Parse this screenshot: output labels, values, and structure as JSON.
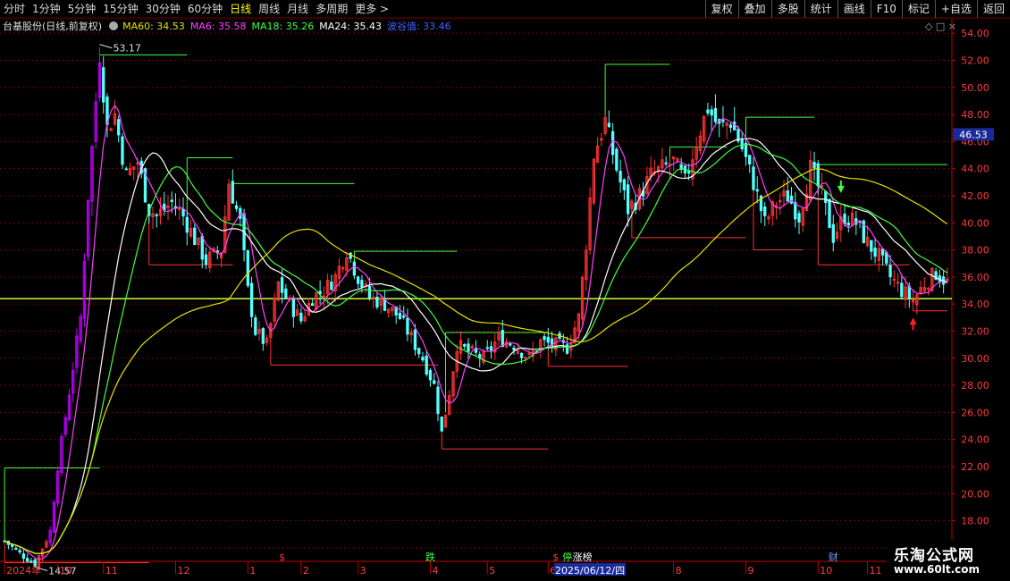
{
  "toolbar": {
    "periods": [
      "分时",
      "1分钟",
      "5分钟",
      "15分钟",
      "30分钟",
      "60分钟",
      "日线",
      "周线",
      "月线",
      "多周期",
      "更多 >"
    ],
    "active_period": "日线",
    "tools": [
      "复权",
      "叠加",
      "多股",
      "统计",
      "画线",
      "F10",
      "标记",
      "+自选",
      "返回"
    ]
  },
  "infobar": {
    "stock": "台基股份(日线,前复权)",
    "ma60": "MA60: 34.53",
    "ma6": "MA6: 35.58",
    "ma18": "MA18: 35.26",
    "ma24": "MA24: 35.43",
    "extra": "波谷值: 33.46"
  },
  "icons": {
    "settings": "gear-icon",
    "diamond": "diamond-icon",
    "close": "close-icon"
  },
  "corner_icons": "◇ □ ×",
  "watermark": {
    "line1": "乐淘公式网",
    "line2": "www.60lt.com"
  },
  "colors": {
    "up": "#ff3232",
    "down": "#54ffff",
    "limit": "#c000ff",
    "ma60": "#e8e000",
    "ma6": "#ff40ff",
    "ma18": "#ffffff",
    "ma24": "#40ff40",
    "grid": "#7a0000",
    "axis": "#c00000"
  },
  "chart_data": {
    "type": "candlestick",
    "title": "台基股份(日线,前复权)",
    "ylim": [
      15,
      55
    ],
    "yticks": [
      16,
      18,
      20,
      22,
      24,
      26,
      28,
      30,
      32,
      34,
      36,
      38,
      40,
      42,
      44,
      46,
      48,
      50,
      52,
      54
    ],
    "last_price": 46.53,
    "month_labels": [
      {
        "label": "2024年",
        "t": 0
      },
      {
        "label": "10",
        "t": 14
      },
      {
        "label": "11",
        "t": 26
      },
      {
        "label": "12",
        "t": 45
      },
      {
        "label": "1",
        "t": 64
      },
      {
        "label": "2",
        "t": 78
      },
      {
        "label": "3",
        "t": 93
      },
      {
        "label": "4",
        "t": 112
      },
      {
        "label": "5",
        "t": 127
      },
      {
        "label": "6",
        "t": 143
      },
      {
        "label": "7",
        "t": 156
      },
      {
        "label": "8",
        "t": 176
      },
      {
        "label": "9",
        "t": 195
      },
      {
        "label": "10",
        "t": 214
      },
      {
        "label": "11",
        "t": 227
      }
    ],
    "date_cursor": {
      "label": "2025/06/12/四",
      "t": 146
    },
    "event_marks": [
      {
        "label": "$",
        "t": 73,
        "color": "#ff3232"
      },
      {
        "label": "跌",
        "t": 112,
        "color": "#40ff40"
      },
      {
        "label": "$",
        "t": 145,
        "color": "#ff3232"
      },
      {
        "label": "停",
        "t": 148,
        "color": "#40ff40"
      },
      {
        "label": "涨榜",
        "t": 152,
        "color": "#ffffff"
      },
      {
        "label": "财",
        "t": 218,
        "color": "#6fa0ff"
      }
    ],
    "annotations": [
      {
        "label": "53.17",
        "t": 25,
        "value": 53.17
      },
      {
        "label": "14.57",
        "t": 8,
        "value": 14.57
      }
    ],
    "horizontal_line": 34.4,
    "arrows": [
      {
        "direction": "down",
        "color": "#40ff40",
        "t": 220,
        "value": 42.2
      },
      {
        "direction": "up",
        "color": "#ff2020",
        "t": 239,
        "value": 33.0
      }
    ],
    "levels": [
      {
        "t0": 25,
        "t1": 48,
        "value": 52.4,
        "color": "#40ff40"
      },
      {
        "t0": 0,
        "t1": 25,
        "value": 21.9,
        "color": "#40ff40"
      },
      {
        "t0": 0,
        "t1": 38,
        "value": 14.9,
        "color": "#ff3232"
      },
      {
        "t0": 48,
        "t1": 60,
        "value": 44.8,
        "color": "#40ff40"
      },
      {
        "t0": 60,
        "t1": 92,
        "value": 42.9,
        "color": "#40ff40"
      },
      {
        "t0": 38,
        "t1": 60,
        "value": 36.9,
        "color": "#ff3232"
      },
      {
        "t0": 92,
        "t1": 119,
        "value": 37.9,
        "color": "#40ff40"
      },
      {
        "t0": 70,
        "t1": 114,
        "value": 29.5,
        "color": "#ff3232"
      },
      {
        "t0": 116,
        "t1": 143,
        "value": 31.9,
        "color": "#40ff40"
      },
      {
        "t0": 115,
        "t1": 143,
        "value": 23.3,
        "color": "#ff3232"
      },
      {
        "t0": 143,
        "t1": 164,
        "value": 29.4,
        "color": "#ff3232"
      },
      {
        "t0": 158,
        "t1": 175,
        "value": 51.7,
        "color": "#40ff40"
      },
      {
        "t0": 175,
        "t1": 190,
        "value": 45.6,
        "color": "#40ff40"
      },
      {
        "t0": 165,
        "t1": 195,
        "value": 38.9,
        "color": "#ff3232"
      },
      {
        "t0": 195,
        "t1": 213,
        "value": 47.8,
        "color": "#40ff40"
      },
      {
        "t0": 213,
        "t1": 248,
        "value": 44.3,
        "color": "#40ff40"
      },
      {
        "t0": 197,
        "t1": 210,
        "value": 38.0,
        "color": "#ff3232"
      },
      {
        "t0": 214,
        "t1": 238,
        "value": 36.9,
        "color": "#ff3232"
      },
      {
        "t0": 239,
        "t1": 248,
        "value": 33.5,
        "color": "#ff3232"
      }
    ],
    "anchors": [
      [
        0,
        16.5
      ],
      [
        4,
        15.6
      ],
      [
        8,
        14.8
      ],
      [
        12,
        17.2
      ],
      [
        14,
        22.0
      ],
      [
        17,
        27.5
      ],
      [
        20,
        33.0
      ],
      [
        22,
        42.0
      ],
      [
        25,
        52.5
      ],
      [
        27,
        47.0
      ],
      [
        29,
        48.0
      ],
      [
        32,
        43.5
      ],
      [
        35,
        44.5
      ],
      [
        38,
        41.0
      ],
      [
        40,
        40.5
      ],
      [
        44,
        41.5
      ],
      [
        47,
        40.5
      ],
      [
        50,
        38.8
      ],
      [
        53,
        37.2
      ],
      [
        57,
        38.0
      ],
      [
        59,
        43.0
      ],
      [
        62,
        40.0
      ],
      [
        64,
        35.0
      ],
      [
        66,
        32.0
      ],
      [
        69,
        31.0
      ],
      [
        72,
        35.5
      ],
      [
        75,
        34.0
      ],
      [
        78,
        32.8
      ],
      [
        81,
        34.5
      ],
      [
        84,
        35.0
      ],
      [
        87,
        36.0
      ],
      [
        90,
        38.0
      ],
      [
        93,
        36.0
      ],
      [
        96,
        34.5
      ],
      [
        100,
        34.0
      ],
      [
        104,
        33.0
      ],
      [
        107,
        31.5
      ],
      [
        110,
        30.0
      ],
      [
        113,
        28.0
      ],
      [
        115,
        24.5
      ],
      [
        117,
        27.5
      ],
      [
        119,
        31.0
      ],
      [
        122,
        30.5
      ],
      [
        126,
        30.0
      ],
      [
        130,
        31.5
      ],
      [
        134,
        31.0
      ],
      [
        138,
        30.0
      ],
      [
        141,
        31.2
      ],
      [
        145,
        31.0
      ],
      [
        148,
        30.8
      ],
      [
        151,
        33.0
      ],
      [
        153,
        38.5
      ],
      [
        155,
        45.0
      ],
      [
        158,
        47.5
      ],
      [
        161,
        44.0
      ],
      [
        164,
        41.0
      ],
      [
        167,
        42.0
      ],
      [
        170,
        43.5
      ],
      [
        173,
        44.0
      ],
      [
        176,
        44.5
      ],
      [
        179,
        43.0
      ],
      [
        182,
        46.0
      ],
      [
        185,
        48.5
      ],
      [
        188,
        47.0
      ],
      [
        191,
        47.5
      ],
      [
        194,
        45.5
      ],
      [
        197,
        43.0
      ],
      [
        200,
        40.0
      ],
      [
        203,
        41.5
      ],
      [
        206,
        42.0
      ],
      [
        209,
        40.5
      ],
      [
        212,
        44.0
      ],
      [
        215,
        42.0
      ],
      [
        218,
        39.0
      ],
      [
        221,
        40.5
      ],
      [
        224,
        40.0
      ],
      [
        227,
        38.5
      ],
      [
        230,
        37.5
      ],
      [
        233,
        36.0
      ],
      [
        236,
        35.0
      ],
      [
        239,
        34.3
      ],
      [
        242,
        35.5
      ],
      [
        245,
        36.3
      ],
      [
        248,
        35.6
      ]
    ],
    "ma_periods": [
      {
        "name": "MA6",
        "period": 6,
        "color": "#ff40ff"
      },
      {
        "name": "MA18",
        "period": 18,
        "color": "#ffffff"
      },
      {
        "name": "MA24",
        "period": 24,
        "color": "#40ff40"
      },
      {
        "name": "MA60",
        "period": 60,
        "color": "#e8e000"
      }
    ]
  }
}
